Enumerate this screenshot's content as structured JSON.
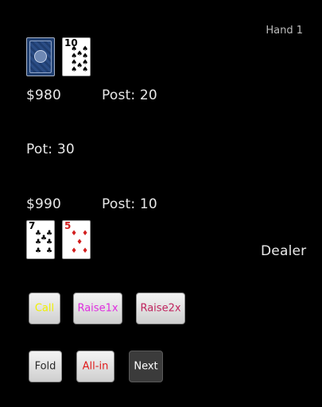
{
  "hand_label": "Hand 1",
  "opponent": {
    "stack": "$980",
    "post": "Post: 20",
    "cards": [
      {
        "face": "back"
      },
      {
        "rank": "10",
        "suit": "♠",
        "color": "black"
      }
    ]
  },
  "pot": "Pot: 30",
  "player": {
    "stack": "$990",
    "post": "Post: 10",
    "cards": [
      {
        "rank": "7",
        "suit": "♣",
        "color": "black"
      },
      {
        "rank": "5",
        "suit": "♦",
        "color": "red"
      }
    ],
    "role": "Dealer"
  },
  "buttons": {
    "call": {
      "label": "Call",
      "color": "#f0f000"
    },
    "raise1x": {
      "label": "Raise1x",
      "color": "#e02ee0"
    },
    "raise2x": {
      "label": "Raise2x",
      "color": "#c0245e"
    },
    "fold": {
      "label": "Fold",
      "color": "#2a2a2a"
    },
    "allin": {
      "label": "All-in",
      "color": "#e01c1c"
    },
    "next": {
      "label": "Next",
      "color": "#ffffff"
    }
  }
}
